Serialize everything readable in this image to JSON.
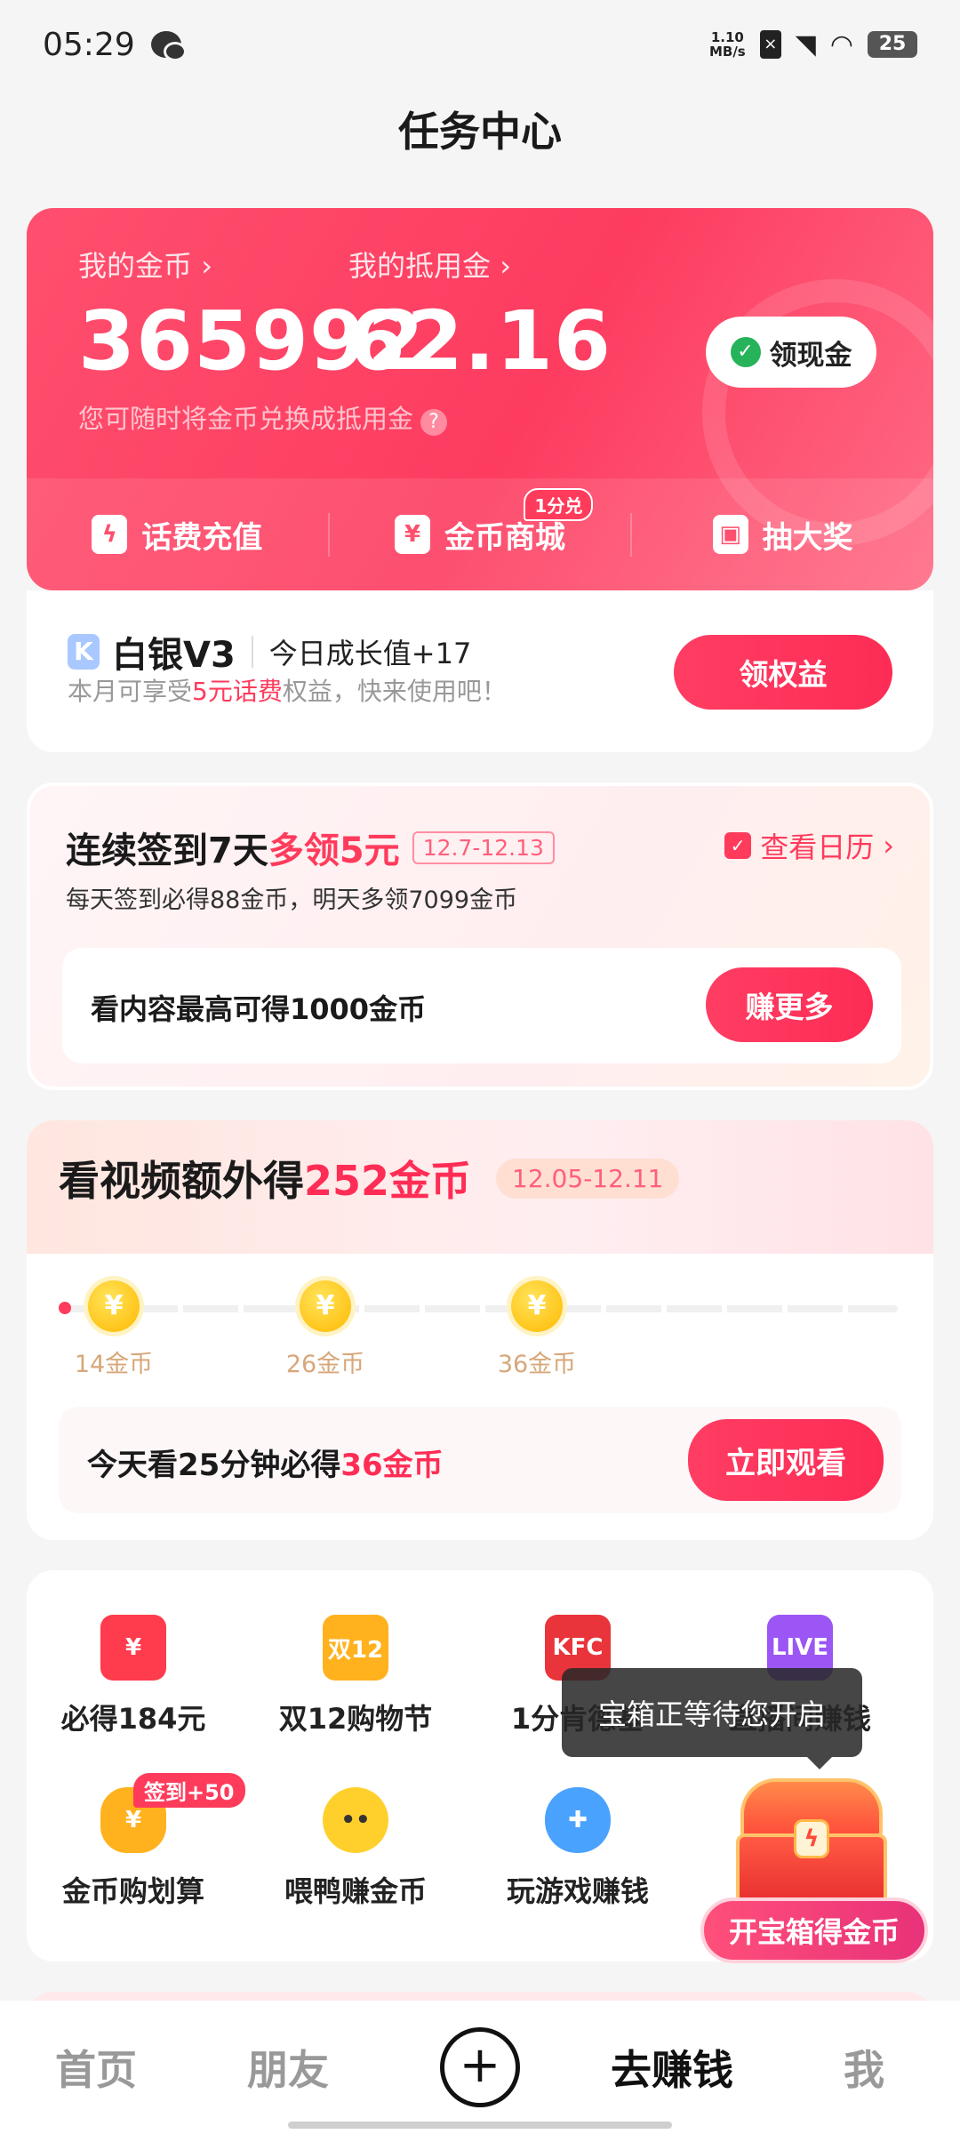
{
  "status_bar": {
    "time": "05:29",
    "net_speed_top": "1.10",
    "net_speed_bottom": "MB/s",
    "battery": "25"
  },
  "header": {
    "title": "任务中心"
  },
  "coins": {
    "my_coins_label": "我的金币",
    "my_coins_value": "365992",
    "voucher_label": "我的抵用金",
    "voucher_value": "62.16",
    "hint": "您可随时将金币兑换成抵用金",
    "withdraw_label": "领现金",
    "actions": [
      {
        "label": "话费充值",
        "icon": "phone-charge-icon"
      },
      {
        "label": "金币商城",
        "icon": "ticket-icon",
        "badge": "1分兑"
      },
      {
        "label": "抽大奖",
        "icon": "gift-icon"
      }
    ]
  },
  "member": {
    "level": "白银V3",
    "growth": "今日成长值+17",
    "sub_before": "本月可享受",
    "sub_highlight": "5元话费",
    "sub_after": "权益，快来使用吧！",
    "button": "领权益"
  },
  "checkin": {
    "title_main": "连续签到7天",
    "title_red": "多领5元",
    "date_range": "12.7-12.13",
    "calendar_link": "查看日历",
    "subtitle": "每天签到必得88金币，明天多领7099金币",
    "inner_text": "看内容最高可得1000金币",
    "button": "赚更多"
  },
  "video": {
    "title_main": "看视频额外得",
    "title_red": "252金币",
    "date_range": "12.05-12.11",
    "milestones": [
      {
        "label": "14金币"
      },
      {
        "label": "26金币"
      },
      {
        "label": "36金币"
      }
    ],
    "inner_before": "今天看25分钟必得",
    "inner_red": "36金币",
    "button": "立即观看"
  },
  "grid": {
    "items": [
      {
        "label": "必得184元",
        "icon": "red-envelope-icon",
        "color": "#ff3b4e"
      },
      {
        "label": "双12购物节",
        "icon": "shopping-cart-icon",
        "color": "#ffb21e",
        "icon_text": "双12"
      },
      {
        "label": "1分肯德基",
        "icon": "kfc-icon",
        "color": "#e8343a",
        "icon_text": "KFC"
      },
      {
        "label": "直播间赚钱",
        "icon": "live-tv-icon",
        "color": "#9b56f5",
        "icon_text": "LIVE"
      },
      {
        "label": "金币购划算",
        "icon": "money-bag-icon",
        "color": "#ffb21e",
        "badge": "签到+50"
      },
      {
        "label": "喂鸭赚金币",
        "icon": "duck-icon",
        "color": "#ffd02b"
      },
      {
        "label": "玩游戏赚钱",
        "icon": "gamepad-icon",
        "color": "#4aa2ff"
      }
    ]
  },
  "treasure": {
    "tooltip": "宝箱正等待您开启",
    "button": "开宝箱得金币"
  },
  "nav": {
    "items": [
      {
        "label": "首页"
      },
      {
        "label": "朋友"
      },
      {
        "label": "去赚钱"
      },
      {
        "label": "我"
      }
    ]
  }
}
